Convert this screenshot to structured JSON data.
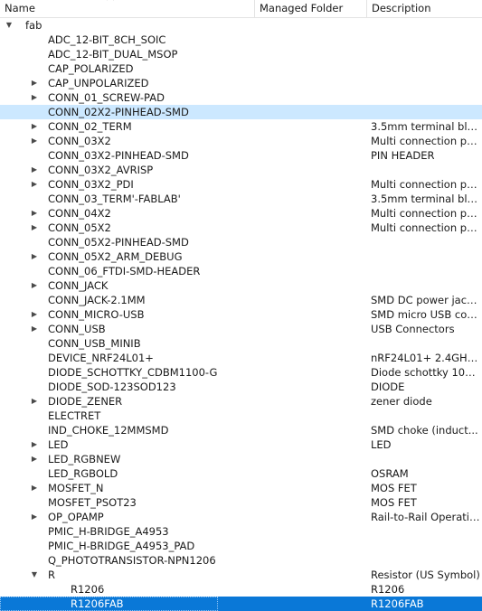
{
  "columns": {
    "name": "Name",
    "managed_folder": "Managed Folder",
    "description": "Description"
  },
  "colors": {
    "soft_selection": "#cce8ff",
    "strong_selection": "#0a78d7",
    "grid": "#e3e3e3"
  },
  "rows": [
    {
      "level": 0,
      "expander": "expanded",
      "name": "fab",
      "desc": ""
    },
    {
      "level": 1,
      "expander": "none",
      "name": "ADC_12-BIT_8CH_SOIC",
      "desc": ""
    },
    {
      "level": 1,
      "expander": "none",
      "name": "ADC_12-BIT_DUAL_MSOP",
      "desc": ""
    },
    {
      "level": 1,
      "expander": "none",
      "name": "CAP_POLARIZED",
      "desc": ""
    },
    {
      "level": 1,
      "expander": "collapsed",
      "name": "CAP_UNPOLARIZED",
      "desc": ""
    },
    {
      "level": 1,
      "expander": "collapsed",
      "name": "CONN_01_SCREW-PAD",
      "desc": ""
    },
    {
      "level": 1,
      "expander": "none",
      "name": "CONN_02X2-PINHEAD-SMD",
      "desc": "",
      "selected": "soft"
    },
    {
      "level": 1,
      "expander": "collapsed",
      "name": "CONN_02_TERM",
      "desc": "3.5mm terminal blo..."
    },
    {
      "level": 1,
      "expander": "collapsed",
      "name": "CONN_03X2",
      "desc": "Multi connection po..."
    },
    {
      "level": 1,
      "expander": "none",
      "name": "CONN_03X2-PINHEAD-SMD",
      "desc": "PIN HEADER"
    },
    {
      "level": 1,
      "expander": "collapsed",
      "name": "CONN_03X2_AVRISP",
      "desc": ""
    },
    {
      "level": 1,
      "expander": "collapsed",
      "name": "CONN_03X2_PDI",
      "desc": "Multi connection po..."
    },
    {
      "level": 1,
      "expander": "none",
      "name": "CONN_03_TERM'-FABLAB'",
      "desc": "3.5mm terminal blo..."
    },
    {
      "level": 1,
      "expander": "collapsed",
      "name": "CONN_04X2",
      "desc": "Multi connection po..."
    },
    {
      "level": 1,
      "expander": "collapsed",
      "name": "CONN_05X2",
      "desc": "Multi connection po..."
    },
    {
      "level": 1,
      "expander": "none",
      "name": "CONN_05X2-PINHEAD-SMD",
      "desc": ""
    },
    {
      "level": 1,
      "expander": "collapsed",
      "name": "CONN_05X2_ARM_DEBUG",
      "desc": ""
    },
    {
      "level": 1,
      "expander": "none",
      "name": "CONN_06_FTDI-SMD-HEADER",
      "desc": ""
    },
    {
      "level": 1,
      "expander": "collapsed",
      "name": "CONN_JACK",
      "desc": ""
    },
    {
      "level": 1,
      "expander": "none",
      "name": "CONN_JACK-2.1MM",
      "desc": "SMD DC power jack..."
    },
    {
      "level": 1,
      "expander": "collapsed",
      "name": "CONN_MICRO-USB",
      "desc": "SMD micro USB con..."
    },
    {
      "level": 1,
      "expander": "collapsed",
      "name": "CONN_USB",
      "desc": "USB Connectors"
    },
    {
      "level": 1,
      "expander": "none",
      "name": "CONN_USB_MINIB",
      "desc": ""
    },
    {
      "level": 1,
      "expander": "none",
      "name": "DEVICE_NRF24L01+",
      "desc": "nRF24L01+ 2.4GHz..."
    },
    {
      "level": 1,
      "expander": "none",
      "name": "DIODE_SCHOTTKY_CDBM1100-G",
      "desc": "Diode schottky 100..."
    },
    {
      "level": 1,
      "expander": "none",
      "name": "DIODE_SOD-123SOD123",
      "desc": "DIODE"
    },
    {
      "level": 1,
      "expander": "collapsed",
      "name": "DIODE_ZENER",
      "desc": "zener diode"
    },
    {
      "level": 1,
      "expander": "none",
      "name": "ELECTRET",
      "desc": ""
    },
    {
      "level": 1,
      "expander": "none",
      "name": "IND_CHOKE_12MMSMD",
      "desc": "SMD choke (induct..."
    },
    {
      "level": 1,
      "expander": "collapsed",
      "name": "LED",
      "desc": "LED"
    },
    {
      "level": 1,
      "expander": "collapsed",
      "name": "LED_RGBNEW",
      "desc": ""
    },
    {
      "level": 1,
      "expander": "none",
      "name": "LED_RGBOLD",
      "desc": "OSRAM"
    },
    {
      "level": 1,
      "expander": "collapsed",
      "name": "MOSFET_N",
      "desc": "MOS FET"
    },
    {
      "level": 1,
      "expander": "none",
      "name": "MOSFET_PSOT23",
      "desc": "MOS FET"
    },
    {
      "level": 1,
      "expander": "collapsed",
      "name": "OP_OPAMP",
      "desc": "Rail-to-Rail Operatio..."
    },
    {
      "level": 1,
      "expander": "none",
      "name": "PMIC_H-BRIDGE_A4953",
      "desc": ""
    },
    {
      "level": 1,
      "expander": "none",
      "name": "PMIC_H-BRIDGE_A4953_PAD",
      "desc": ""
    },
    {
      "level": 1,
      "expander": "none",
      "name": "Q_PHOTOTRANSISTOR-NPN1206",
      "desc": ""
    },
    {
      "level": 1,
      "expander": "expanded",
      "name": "R",
      "desc": "Resistor (US Symbol)"
    },
    {
      "level": 2,
      "expander": "none",
      "name": "R1206",
      "desc": "R1206"
    },
    {
      "level": 2,
      "expander": "none",
      "name": "R1206FAB",
      "desc": "R1206FAB",
      "selected": "strong"
    }
  ]
}
